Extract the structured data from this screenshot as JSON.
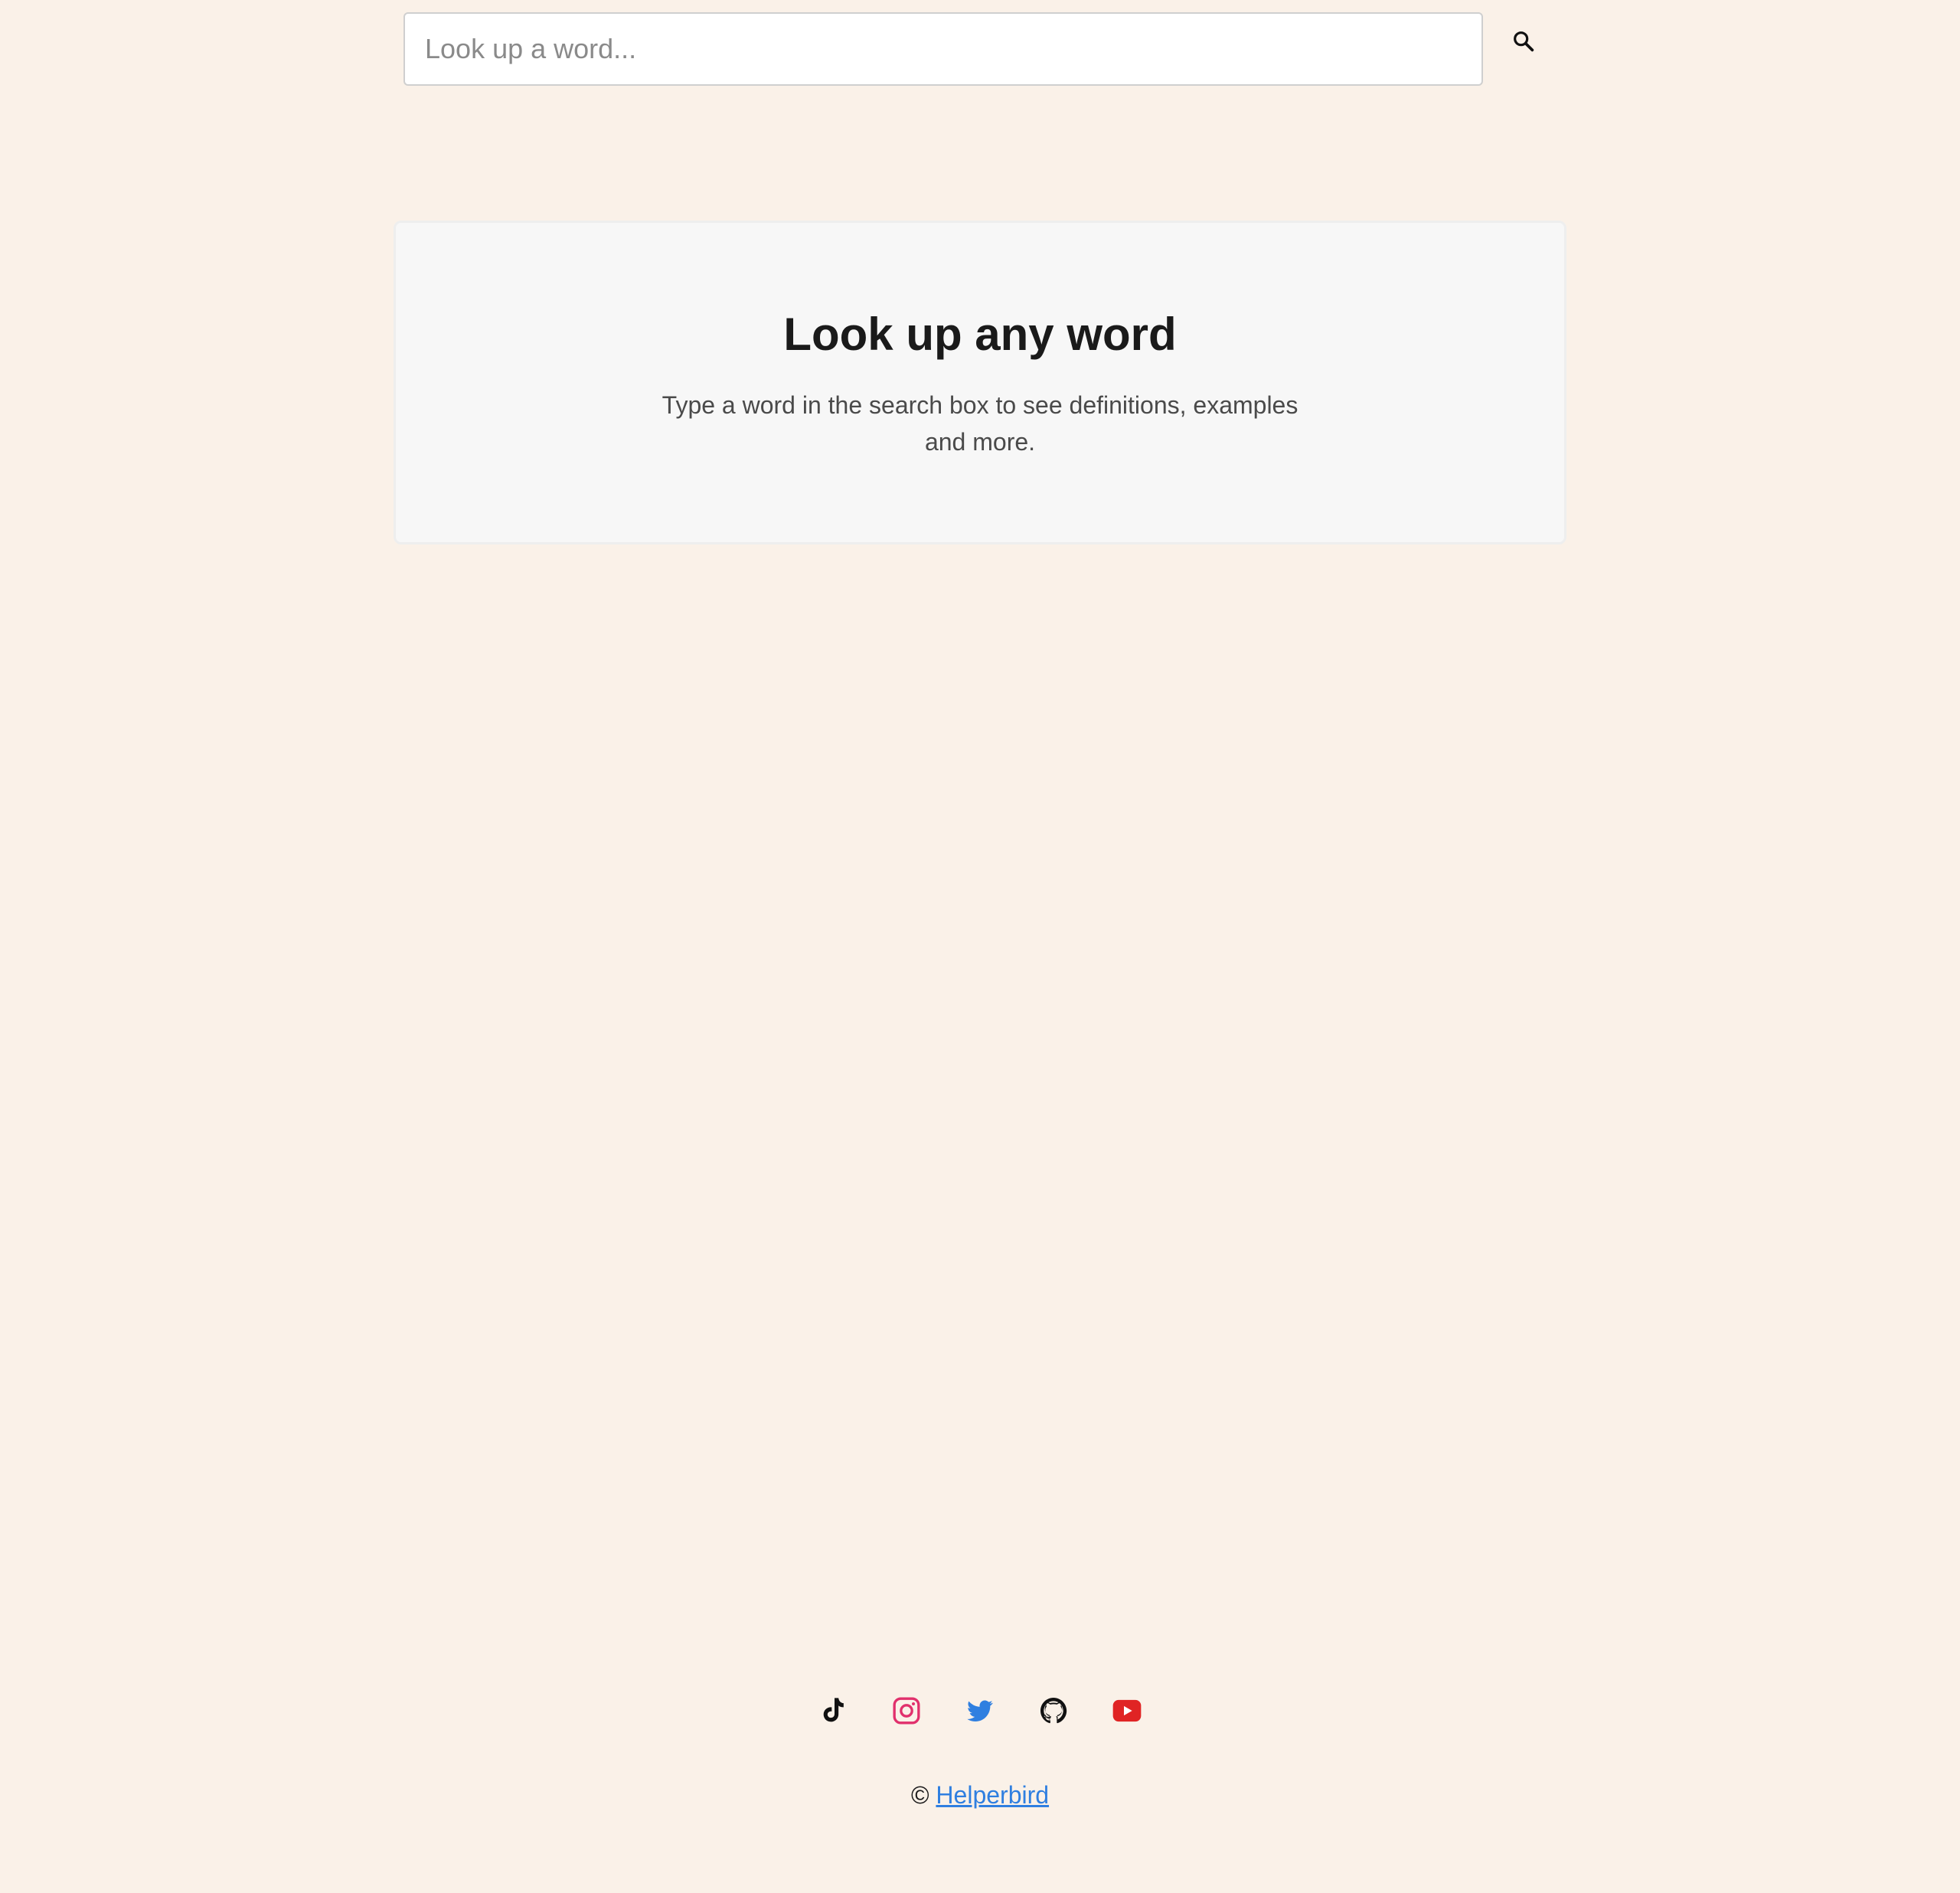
{
  "search": {
    "placeholder": "Look up a word...",
    "value": ""
  },
  "card": {
    "title": "Look up any word",
    "description": "Type a word in the search box to see definitions, examples and more."
  },
  "social": [
    {
      "icon": "tiktok-icon",
      "color": "#111111"
    },
    {
      "icon": "instagram-icon",
      "color": "#E1306C"
    },
    {
      "icon": "twitter-icon",
      "color": "#2F7FE0"
    },
    {
      "icon": "github-icon",
      "color": "#111111"
    },
    {
      "icon": "youtube-icon",
      "color": "#E02424"
    }
  ],
  "footer": {
    "copyright_symbol": "©",
    "brand_link": "Helperbird"
  },
  "colors": {
    "background": "#FAF1E8",
    "card_background": "#F7F7F7",
    "link": "#2F7FE0"
  }
}
